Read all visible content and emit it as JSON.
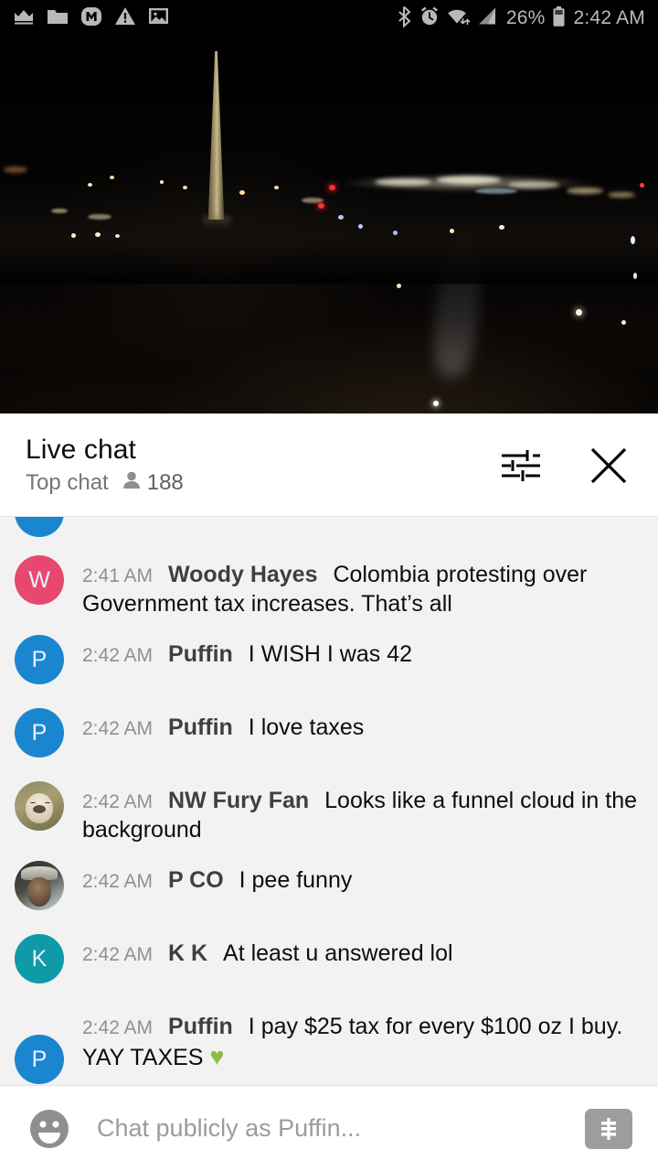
{
  "status_bar": {
    "left_icons": [
      "crown-icon",
      "folder-icon",
      "m-badge-icon",
      "warning-triangle-icon",
      "image-icon"
    ],
    "right_icons": [
      "bluetooth-icon",
      "alarm-clock-icon",
      "wifi-icon",
      "cellular-signal-icon",
      "battery-icon"
    ],
    "battery_percent": "26%",
    "time": "2:42 AM"
  },
  "video": {
    "scene_description": "Washington Monument at night",
    "progress_color": "#e52117"
  },
  "chat_header": {
    "title": "Live chat",
    "subtitle": "Top chat",
    "viewer_count": "188",
    "settings_icon": "tune-icon",
    "close_icon": "close-icon"
  },
  "messages": [
    {
      "partial": true,
      "avatar": {
        "type": "letter",
        "letter": "",
        "color": "#1a86d0"
      },
      "time": "",
      "author": "",
      "text": ""
    },
    {
      "partial": false,
      "avatar": {
        "type": "letter",
        "letter": "W",
        "color": "#e8476f"
      },
      "time": "2:41 AM",
      "author": "Woody Hayes",
      "text": "Colombia protesting over Government tax increases. That’s all"
    },
    {
      "partial": false,
      "avatar": {
        "type": "letter",
        "letter": "P",
        "color": "#1a86d0"
      },
      "time": "2:42 AM",
      "author": "Puffin",
      "text": "I WISH I was 42"
    },
    {
      "partial": false,
      "avatar": {
        "type": "letter",
        "letter": "P",
        "color": "#1a86d0"
      },
      "time": "2:42 AM",
      "author": "Puffin",
      "text": "I love taxes"
    },
    {
      "partial": false,
      "avatar": {
        "type": "photo",
        "photo": "dog-avatar"
      },
      "time": "2:42 AM",
      "author": "NW Fury Fan",
      "text": "Looks like a funnel cloud in the background"
    },
    {
      "partial": false,
      "avatar": {
        "type": "photo",
        "photo": "man-avatar"
      },
      "time": "2:42 AM",
      "author": "P CO",
      "text": "I pee funny"
    },
    {
      "partial": false,
      "avatar": {
        "type": "letter",
        "letter": "K",
        "color": "#0e9aa7"
      },
      "time": "2:42 AM",
      "author": "K K",
      "text": "At least u answered lol"
    },
    {
      "partial": false,
      "avatar": {
        "type": "letter",
        "letter": "P",
        "color": "#1a86d0"
      },
      "time": "2:42 AM",
      "author": "Puffin",
      "text": "I pay $25 tax for every $100 oz I buy. YAY TAXES ",
      "emoji": "♥"
    }
  ],
  "input_bar": {
    "emoji_icon": "emoji-face-icon",
    "placeholder": "Chat publicly as Puffin...",
    "value": "",
    "superchat_icon": "dollar-sign-icon"
  },
  "colors": {
    "accent_red": "#e52117",
    "chat_bg": "#f2f2f2",
    "avatar_blue": "#1a86d0",
    "avatar_pink": "#e8476f",
    "avatar_teal": "#0e9aa7",
    "heart_green": "#8dbf3f"
  }
}
